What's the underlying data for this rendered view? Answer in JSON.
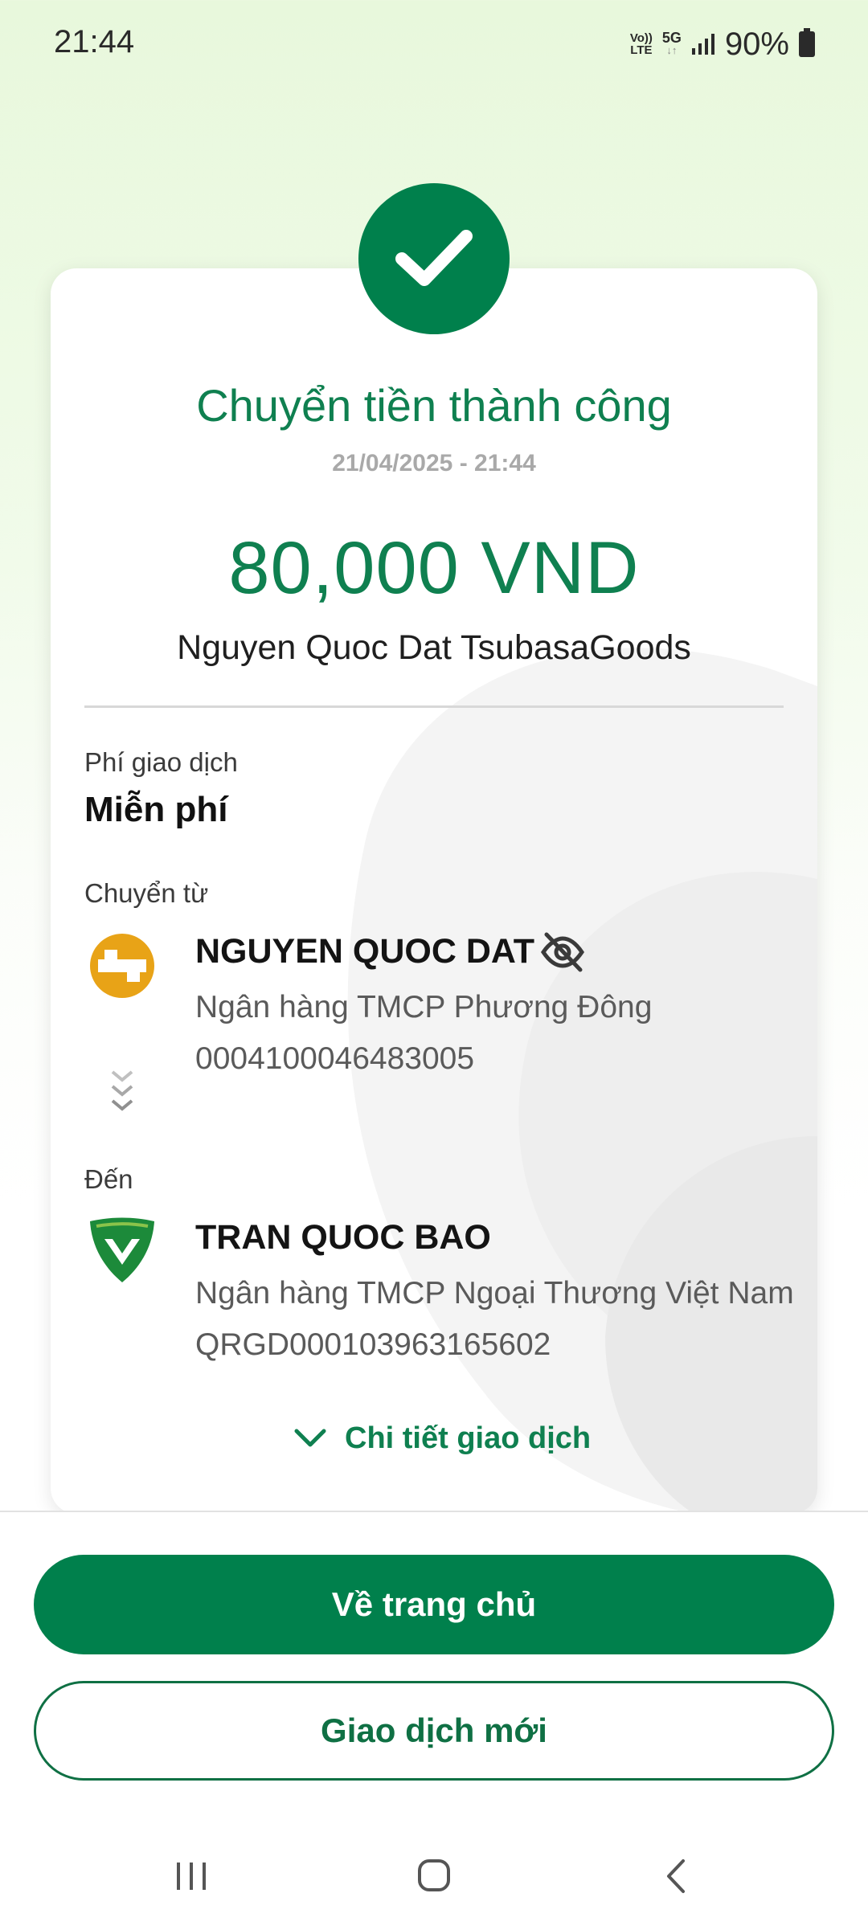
{
  "status_bar": {
    "time": "21:44",
    "volte_top": "Vo))",
    "volte_bottom": "LTE",
    "network": "5G",
    "battery": "90%"
  },
  "receipt": {
    "title": "Chuyển tiền thành công",
    "datetime": "21/04/2025 - 21:44",
    "amount": "80,000 VND",
    "description": "Nguyen Quoc Dat TsubasaGoods",
    "fee_label": "Phí giao dịch",
    "fee_value": "Miễn phí",
    "from_label": "Chuyển từ",
    "from": {
      "name": "NGUYEN QUOC DAT",
      "bank": "Ngân hàng TMCP Phương Đông",
      "account": "0004100046483005"
    },
    "to_label": "Đến",
    "to": {
      "name": "TRAN QUOC BAO",
      "bank": "Ngân hàng TMCP Ngoại Thương Việt Nam",
      "account": "QRGD000103963165602"
    },
    "details_toggle": "Chi tiết giao dịch"
  },
  "actions": {
    "home": "Về trang chủ",
    "new_transaction": "Giao dịch mới"
  },
  "colors": {
    "brand_green": "#00804c",
    "ocb_orange": "#e8a317",
    "vcb_green": "#1c8a3a"
  },
  "icons": {
    "success": "check-icon",
    "hide_balance": "eye-off-icon",
    "transfer_arrows": "chevrons-down-icon",
    "toggle": "chevron-down-icon",
    "nav": [
      "recent-apps-icon",
      "home-icon",
      "back-icon"
    ]
  }
}
